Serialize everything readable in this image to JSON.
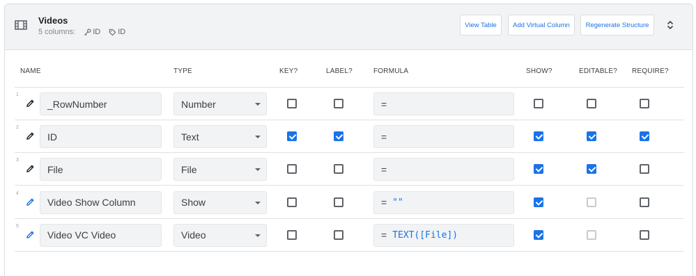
{
  "table": {
    "title": "Videos",
    "columns_count": "5 columns:",
    "key_label": "ID",
    "label_label": "ID"
  },
  "buttons": {
    "view_table": "View Table",
    "add_virtual_column": "Add Virtual Column",
    "regenerate_structure": "Regenerate Structure"
  },
  "headers": {
    "name": "NAME",
    "type": "TYPE",
    "key": "KEY?",
    "label": "LABEL?",
    "formula": "FORMULA",
    "show": "SHOW?",
    "editable": "EDITABLE?",
    "require": "REQUIRE?"
  },
  "rows": [
    {
      "num": "1",
      "name": "_RowNumber",
      "type": "Number",
      "formula_prefix": "=",
      "formula": "",
      "key": false,
      "label": false,
      "show": false,
      "editable": false,
      "editable_disabled": false,
      "require": false,
      "virtual": false
    },
    {
      "num": "2",
      "name": "ID",
      "type": "Text",
      "formula_prefix": "=",
      "formula": "",
      "key": true,
      "label": true,
      "show": true,
      "editable": true,
      "editable_disabled": false,
      "require": true,
      "virtual": false
    },
    {
      "num": "3",
      "name": "File",
      "type": "File",
      "formula_prefix": "=",
      "formula": "",
      "key": false,
      "label": false,
      "show": true,
      "editable": true,
      "editable_disabled": false,
      "require": false,
      "virtual": false
    },
    {
      "num": "4",
      "name": "Video Show Column",
      "type": "Show",
      "formula_prefix": "=",
      "formula": "\"\"",
      "key": false,
      "label": false,
      "show": true,
      "editable": false,
      "editable_disabled": true,
      "require": false,
      "virtual": true
    },
    {
      "num": "5",
      "name": "Video VC Video",
      "type": "Video",
      "formula_prefix": "=",
      "formula": "TEXT([File])",
      "key": false,
      "label": false,
      "show": true,
      "editable": false,
      "editable_disabled": true,
      "require": false,
      "virtual": true
    }
  ],
  "colors": {
    "accent": "#1a73e8",
    "header_bg": "#f1f3f4"
  }
}
